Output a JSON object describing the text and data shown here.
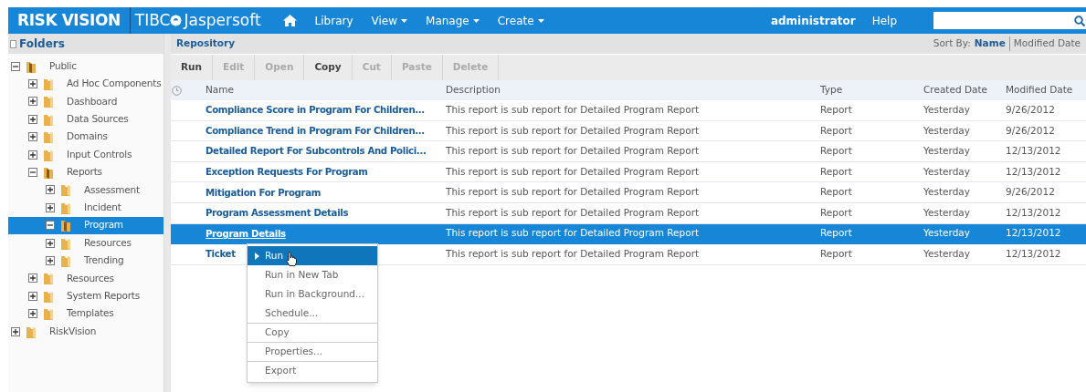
{
  "header": {
    "brand": "RISK VISION",
    "vendor_left": "TIBC",
    "vendor_right": "Jaspersoft",
    "nav": [
      {
        "label": "Library",
        "has_menu": false
      },
      {
        "label": "View",
        "has_menu": true
      },
      {
        "label": "Manage",
        "has_menu": true
      },
      {
        "label": "Create",
        "has_menu": true
      }
    ],
    "user": "administrator",
    "help": "Help"
  },
  "folders": {
    "title": "Folders",
    "tree": [
      {
        "label": "Public",
        "expanded": true,
        "selected": false,
        "children": [
          {
            "label": "Ad Hoc Components",
            "expanded": false,
            "selected": false
          },
          {
            "label": "Dashboard",
            "expanded": false,
            "selected": false
          },
          {
            "label": "Data Sources",
            "expanded": false,
            "selected": false
          },
          {
            "label": "Domains",
            "expanded": false,
            "selected": false
          },
          {
            "label": "Input Controls",
            "expanded": false,
            "selected": false
          },
          {
            "label": "Reports",
            "expanded": true,
            "selected": false,
            "children": [
              {
                "label": "Assessment",
                "expanded": false,
                "selected": false
              },
              {
                "label": "Incident",
                "expanded": false,
                "selected": false
              },
              {
                "label": "Program",
                "expanded": true,
                "selected": true
              },
              {
                "label": "Resources",
                "expanded": false,
                "selected": false
              },
              {
                "label": "Trending",
                "expanded": false,
                "selected": false
              }
            ]
          },
          {
            "label": "Resources",
            "expanded": false,
            "selected": false
          },
          {
            "label": "System Reports",
            "expanded": false,
            "selected": false
          },
          {
            "label": "Templates",
            "expanded": false,
            "selected": false
          }
        ]
      },
      {
        "label": "RiskVision",
        "expanded": false,
        "selected": false
      }
    ]
  },
  "repository": {
    "title": "Repository",
    "sort_label": "Sort By:",
    "sort_options": [
      {
        "label": "Name",
        "selected": true
      },
      {
        "label": "Modified Date",
        "selected": false
      }
    ],
    "toolbar": [
      {
        "label": "Run",
        "disabled": false
      },
      {
        "label": "Edit",
        "disabled": true
      },
      {
        "label": "Open",
        "disabled": true
      },
      {
        "label": "Copy",
        "disabled": false
      },
      {
        "label": "Cut",
        "disabled": true
      },
      {
        "label": "Paste",
        "disabled": true
      },
      {
        "label": "Delete",
        "disabled": true
      }
    ],
    "columns": [
      "Name",
      "Description",
      "Type",
      "Created Date",
      "Modified Date"
    ],
    "rows": [
      {
        "name": "Compliance Score in Program For Children...",
        "description": "This report is sub report for Detailed Program Report",
        "type": "Report",
        "created": "Yesterday",
        "modified": "9/26/2012",
        "selected": false
      },
      {
        "name": "Compliance Trend in Program For Children...",
        "description": "This report is sub report for Detailed Program Report",
        "type": "Report",
        "created": "Yesterday",
        "modified": "9/26/2012",
        "selected": false
      },
      {
        "name": "Detailed Report For Subcontrols And Polici...",
        "description": "This report is sub report for Detailed Program Report",
        "type": "Report",
        "created": "Yesterday",
        "modified": "12/13/2012",
        "selected": false
      },
      {
        "name": "Exception Requests For Program",
        "description": "This report is sub report for Detailed Program Report",
        "type": "Report",
        "created": "Yesterday",
        "modified": "12/13/2012",
        "selected": false
      },
      {
        "name": "Mitigation For Program",
        "description": "This report is sub report for Detailed Program Report",
        "type": "Report",
        "created": "Yesterday",
        "modified": "9/26/2012",
        "selected": false
      },
      {
        "name": "Program Assessment Details",
        "description": "This report is sub report for Detailed Program Report",
        "type": "Report",
        "created": "Yesterday",
        "modified": "12/13/2012",
        "selected": false
      },
      {
        "name": "Program Details",
        "description": "This report is sub report for Detailed Program Report",
        "type": "Report",
        "created": "Yesterday",
        "modified": "12/13/2012",
        "selected": true
      },
      {
        "name": "Ticket",
        "description": "This report is sub report for Detailed Program Report",
        "type": "Report",
        "created": "Yesterday",
        "modified": "12/13/2012",
        "selected": false
      }
    ]
  },
  "context_menu": {
    "items": [
      {
        "label": "Run",
        "selected": true,
        "separator_before": false
      },
      {
        "label": "Run in New Tab",
        "selected": false,
        "separator_before": false
      },
      {
        "label": "Run in Background...",
        "selected": false,
        "separator_before": false
      },
      {
        "label": "Schedule...",
        "selected": false,
        "separator_before": false
      },
      {
        "label": "Copy",
        "selected": false,
        "separator_before": true
      },
      {
        "label": "Properties...",
        "selected": false,
        "separator_before": true
      },
      {
        "label": "Export",
        "selected": false,
        "separator_before": true
      }
    ]
  }
}
